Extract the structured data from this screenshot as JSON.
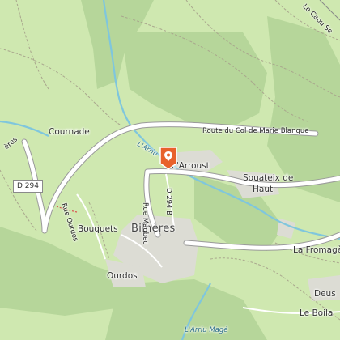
{
  "map": {
    "colors": {
      "land": "#cfe8b0",
      "forest": "#b6d69a",
      "built": "#dcdcd4",
      "road": "#ffffff",
      "water": "#7fc6dd",
      "marker": "#e8612c"
    },
    "labels": {
      "route_col": "Route du Col de Marie Blanque",
      "cournade": "Cournade",
      "arroust": "L'Arroust",
      "souateix": "Souateix de",
      "haut": "Haut",
      "d294": "D 294",
      "bouquets": "Bouquets",
      "bilheres": "Bilhères",
      "ourdos": "Ourdos",
      "rue_ourdos": "Rue Ourdos",
      "rue_maubec": "Rue Maubec",
      "d294b": "D 294 B",
      "la_fromage": "La Fromagè",
      "deus": "Deus",
      "le_boila": "Le Boila",
      "arriu_mage": "L'Arriu Magé",
      "arriu": "L'Arriu",
      "cami": "Le Caou Se",
      "eres": "ères"
    },
    "marker": {
      "icon": "map-pin-icon"
    }
  }
}
